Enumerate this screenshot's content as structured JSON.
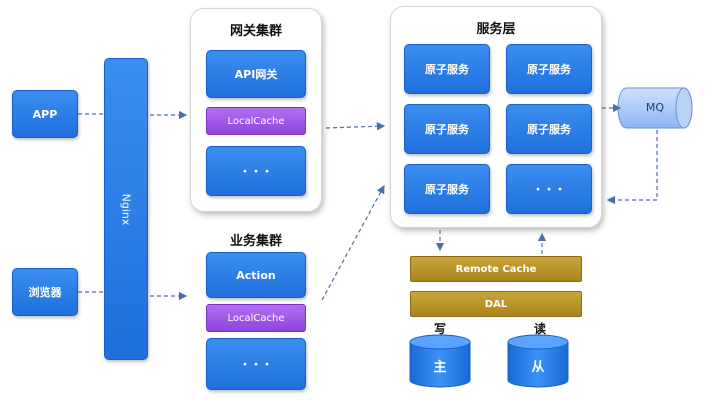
{
  "clients": {
    "app": "APP",
    "browser": "浏览器"
  },
  "nginx": "Nginx",
  "gateway": {
    "title": "网关集群",
    "api": "API网关",
    "cache": "LocalCache",
    "more": "・・・"
  },
  "business": {
    "title": "业务集群",
    "action": "Action",
    "cache": "LocalCache",
    "more": "・・・"
  },
  "service": {
    "title": "服务层",
    "atom": "原子服务",
    "more": "・・・"
  },
  "mq": "MQ",
  "remote_cache": "Remote Cache",
  "dal": "DAL",
  "db": {
    "write_label": "写",
    "read_label": "读",
    "master": "主",
    "slave": "从"
  },
  "colors": {
    "blue": "#1f6fdc",
    "purple": "#8f43dd",
    "gold": "#a8841c",
    "cylinder": "#1f78e8"
  }
}
